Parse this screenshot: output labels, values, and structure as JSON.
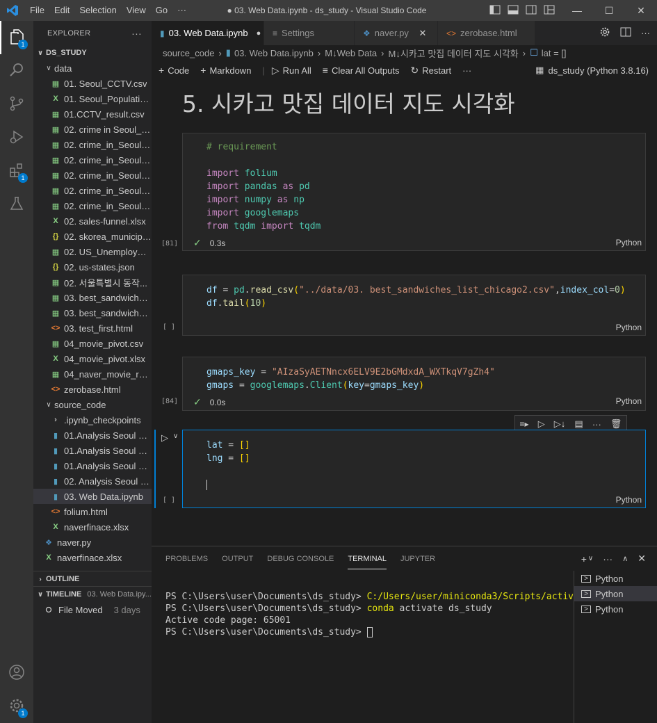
{
  "titlebar": {
    "menu": [
      "File",
      "Edit",
      "Selection",
      "View",
      "Go",
      "···"
    ],
    "title": "● 03. Web Data.ipynb - ds_study - Visual Studio Code"
  },
  "sidebar": {
    "header": "EXPLORER",
    "more": "···",
    "root": "DS_STUDY",
    "folder_data": "data",
    "data_files": [
      {
        "name": "01. Seoul_CCTV.csv",
        "type": "csv"
      },
      {
        "name": "01. Seoul_Populatio...",
        "type": "xlsx"
      },
      {
        "name": "01.CCTV_result.csv",
        "type": "csv"
      },
      {
        "name": "02. crime in Seoul_fi...",
        "type": "csv"
      },
      {
        "name": "02. crime_in_Seoul_1...",
        "type": "csv"
      },
      {
        "name": "02. crime_in_Seoul_fi...",
        "type": "csv"
      },
      {
        "name": "02. crime_in_Seoul_l...",
        "type": "csv"
      },
      {
        "name": "02. crime_in_Seoul_r...",
        "type": "csv"
      },
      {
        "name": "02. crime_in_Seoul.csv",
        "type": "csv"
      },
      {
        "name": "02. sales-funnel.xlsx",
        "type": "xlsx"
      },
      {
        "name": "02. skorea_municipa...",
        "type": "json"
      },
      {
        "name": "02. US_Unemploym...",
        "type": "csv"
      },
      {
        "name": "02. us-states.json",
        "type": "json"
      },
      {
        "name": "02. 서울특별시 동작...",
        "type": "csv"
      },
      {
        "name": "03. best_sandwiches...",
        "type": "csv"
      },
      {
        "name": "03. best_sandwiches...",
        "type": "csv"
      },
      {
        "name": "03. test_first.html",
        "type": "html"
      },
      {
        "name": "04_movie_pivot.csv",
        "type": "csv"
      },
      {
        "name": "04_movie_pivot.xlsx",
        "type": "xlsx"
      },
      {
        "name": "04_naver_movie_raw...",
        "type": "csv"
      },
      {
        "name": "zerobase.html",
        "type": "html"
      }
    ],
    "folder_source": "source_code",
    "source_files": [
      {
        "name": ".ipynb_checkpoints",
        "type": "folder"
      },
      {
        "name": "01.Analysis Seoul CC...",
        "type": "ipynb"
      },
      {
        "name": "01.Analysis Seoul CC...",
        "type": "ipynb"
      },
      {
        "name": "01.Analysis Seoul CC...",
        "type": "ipynb"
      },
      {
        "name": "02. Analysis Seoul Cr...",
        "type": "ipynb"
      },
      {
        "name": "03. Web Data.ipynb",
        "type": "ipynb",
        "selected": true
      },
      {
        "name": "folium.html",
        "type": "html"
      },
      {
        "name": "naverfinace.xlsx",
        "type": "xlsx"
      }
    ],
    "root_files": [
      {
        "name": "naver.py",
        "type": "py"
      },
      {
        "name": "naverfinace.xlsx",
        "type": "xlsx"
      }
    ],
    "outline": "OUTLINE",
    "timeline": "TIMELINE",
    "timeline_file": "03. Web Data.ipy...",
    "timeline_item": "File Moved",
    "timeline_time": "3 days"
  },
  "badges": {
    "explorer": "1",
    "extensions": "1",
    "settings": "1"
  },
  "tabs": [
    {
      "label": "03. Web Data.ipynb",
      "icon": "notebook",
      "active": true,
      "close": "●"
    },
    {
      "label": "Settings",
      "icon": "settings",
      "active": false,
      "close": ""
    },
    {
      "label": "naver.py",
      "icon": "python",
      "active": false,
      "close": "✕"
    },
    {
      "label": "zerobase.html",
      "icon": "html",
      "active": false,
      "close": ""
    }
  ],
  "breadcrumb": [
    "source_code",
    "03. Web Data.ipynb",
    "M↓Web Data",
    "M↓시카고 맛집 데이터 지도 시각화",
    "lat = []"
  ],
  "toolbar": {
    "code": "Code",
    "markdown": "Markdown",
    "run_all": "Run All",
    "clear_outputs": "Clear All Outputs",
    "restart": "Restart",
    "more": "···",
    "kernel": "ds_study (Python 3.8.16)"
  },
  "notebook": {
    "heading": "5. 시카고 맛집 데이터 지도 시각화",
    "cells": [
      {
        "count": "[81]",
        "status": "0.3s",
        "lang": "Python"
      },
      {
        "count": "[ ]",
        "status": "",
        "lang": "Python"
      },
      {
        "count": "[84]",
        "status": "0.0s",
        "lang": "Python"
      },
      {
        "count": "[ ]",
        "status": "",
        "lang": "Python"
      }
    ],
    "code": {
      "c1_comment": "# requirement",
      "c1_l1_kw": "import",
      "c1_l1_mod": "folium",
      "c1_l2_kw": "import",
      "c1_l2_mod": "pandas",
      "c1_l2_as": "as",
      "c1_l2_alias": "pd",
      "c1_l3_kw": "import",
      "c1_l3_mod": "numpy",
      "c1_l3_as": "as",
      "c1_l3_alias": "np",
      "c1_l4_kw": "import",
      "c1_l4_mod": "googlemaps",
      "c1_l5_kw": "from",
      "c1_l5_mod": "tqdm",
      "c1_l5_kw2": "import",
      "c1_l5_name": "tqdm",
      "c2_l1_var": "df",
      "c2_l1_pd": "pd",
      "c2_l1_fn": "read_csv",
      "c2_l1_str": "\"../data/03. best_sandwiches_list_chicago2.csv\"",
      "c2_l1_kwarg": "index_col",
      "c2_l1_num": "0",
      "c2_l2_var": "df",
      "c2_l2_fn": "tail",
      "c2_l2_num": "10",
      "c3_l1_var": "gmaps_key",
      "c3_l1_str": "\"AIzaSyAETNncx6ELV9E2bGMdxdA_WXTkqV7gZh4\"",
      "c3_l2_var": "gmaps",
      "c3_l2_mod": "googlemaps",
      "c3_l2_cls": "Client",
      "c3_l2_kw": "key",
      "c3_l2_val": "gmaps_key",
      "c4_l1_var": "lat",
      "c4_l2_var": "lng"
    }
  },
  "panel": {
    "tabs": [
      "PROBLEMS",
      "OUTPUT",
      "DEBUG CONSOLE",
      "TERMINAL",
      "JUPYTER"
    ],
    "active_tab": "TERMINAL",
    "terminal": {
      "l1_prompt": "PS C:\\Users\\user\\Documents\\ds_study> ",
      "l1_cmd": "C:/Users/user/miniconda3/Scripts/activate",
      "l2_prompt": "PS C:\\Users\\user\\Documents\\ds_study> ",
      "l2_cmd_y": "conda",
      "l2_cmd_rest": " activate ds_study",
      "l3": "Active code page: 65001",
      "l4_prompt": "PS C:\\Users\\user\\Documents\\ds_study> "
    },
    "terminals": [
      "Python",
      "Python",
      "Python"
    ]
  },
  "colors": {
    "accent": "#007acc",
    "focus_border": "#007fd4",
    "success": "#89d185"
  }
}
